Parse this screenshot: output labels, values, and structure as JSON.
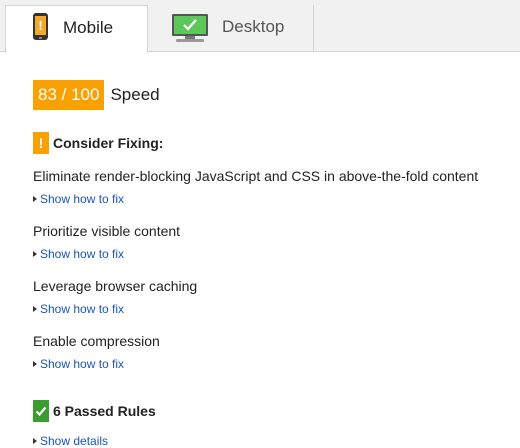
{
  "tabs": {
    "mobile": {
      "label": "Mobile",
      "icon": "mobile-phone-icon",
      "active": true
    },
    "desktop": {
      "label": "Desktop",
      "icon": "desktop-monitor-icon",
      "active": false
    }
  },
  "score": {
    "badge": "83 / 100",
    "label": "Speed",
    "color": "#f8a100"
  },
  "consider_fixing": {
    "icon": "warning-icon",
    "icon_text": "!",
    "heading": "Consider Fixing:",
    "rules": [
      {
        "title": "Eliminate render-blocking JavaScript and CSS in above-the-fold content",
        "link": "Show how to fix"
      },
      {
        "title": "Prioritize visible content",
        "link": "Show how to fix"
      },
      {
        "title": "Leverage browser caching",
        "link": "Show how to fix"
      },
      {
        "title": "Enable compression",
        "link": "Show how to fix"
      }
    ]
  },
  "passed": {
    "icon": "check-icon",
    "heading": "6 Passed Rules",
    "link": "Show details",
    "color": "#3a9d2f"
  },
  "colors": {
    "accent_orange": "#f8a100",
    "link_blue": "#1a55b8",
    "pass_green": "#3a9d2f"
  }
}
